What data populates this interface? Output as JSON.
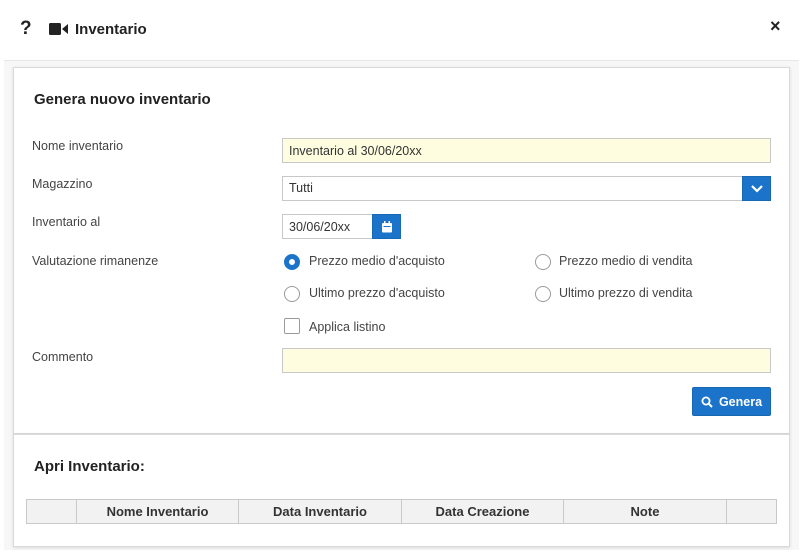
{
  "window": {
    "title": "Inventario",
    "help_glyph": "?",
    "close_glyph": "×",
    "icons": [
      "help-icon",
      "video-icon",
      "close-icon"
    ]
  },
  "generate_section": {
    "title": "Genera nuovo inventario",
    "fields": {
      "name": {
        "label": "Nome inventario",
        "value": "Inventario al 30/06/20xx"
      },
      "warehouse": {
        "label": "Magazzino",
        "value": "Tutti",
        "icon": "chevron-down-icon"
      },
      "date": {
        "label": "Inventario al",
        "value": "30/06/20xx",
        "icon": "calendar-icon"
      },
      "valuation": {
        "label": "Valutazione rimanenze",
        "options": [
          "Prezzo medio d'acquisto",
          "Prezzo medio di vendita",
          "Ultimo prezzo d'acquisto",
          "Ultimo prezzo di vendita"
        ],
        "selected": "Prezzo medio d'acquisto"
      },
      "apply_price_list": {
        "label": "Applica listino",
        "checked": false
      },
      "comment": {
        "label": "Commento",
        "value": ""
      }
    },
    "generate_button": {
      "label": "Genera",
      "icon": "search-icon"
    }
  },
  "open_section": {
    "title": "Apri Inventario:",
    "table_headers": [
      "",
      "Nome Inventario",
      "Data Inventario",
      "Data Creazione",
      "Note",
      ""
    ]
  },
  "colors": {
    "accent": "#1b74c9",
    "input_highlight": "#fffde0",
    "table_header_bg": "#f2f2f2"
  }
}
